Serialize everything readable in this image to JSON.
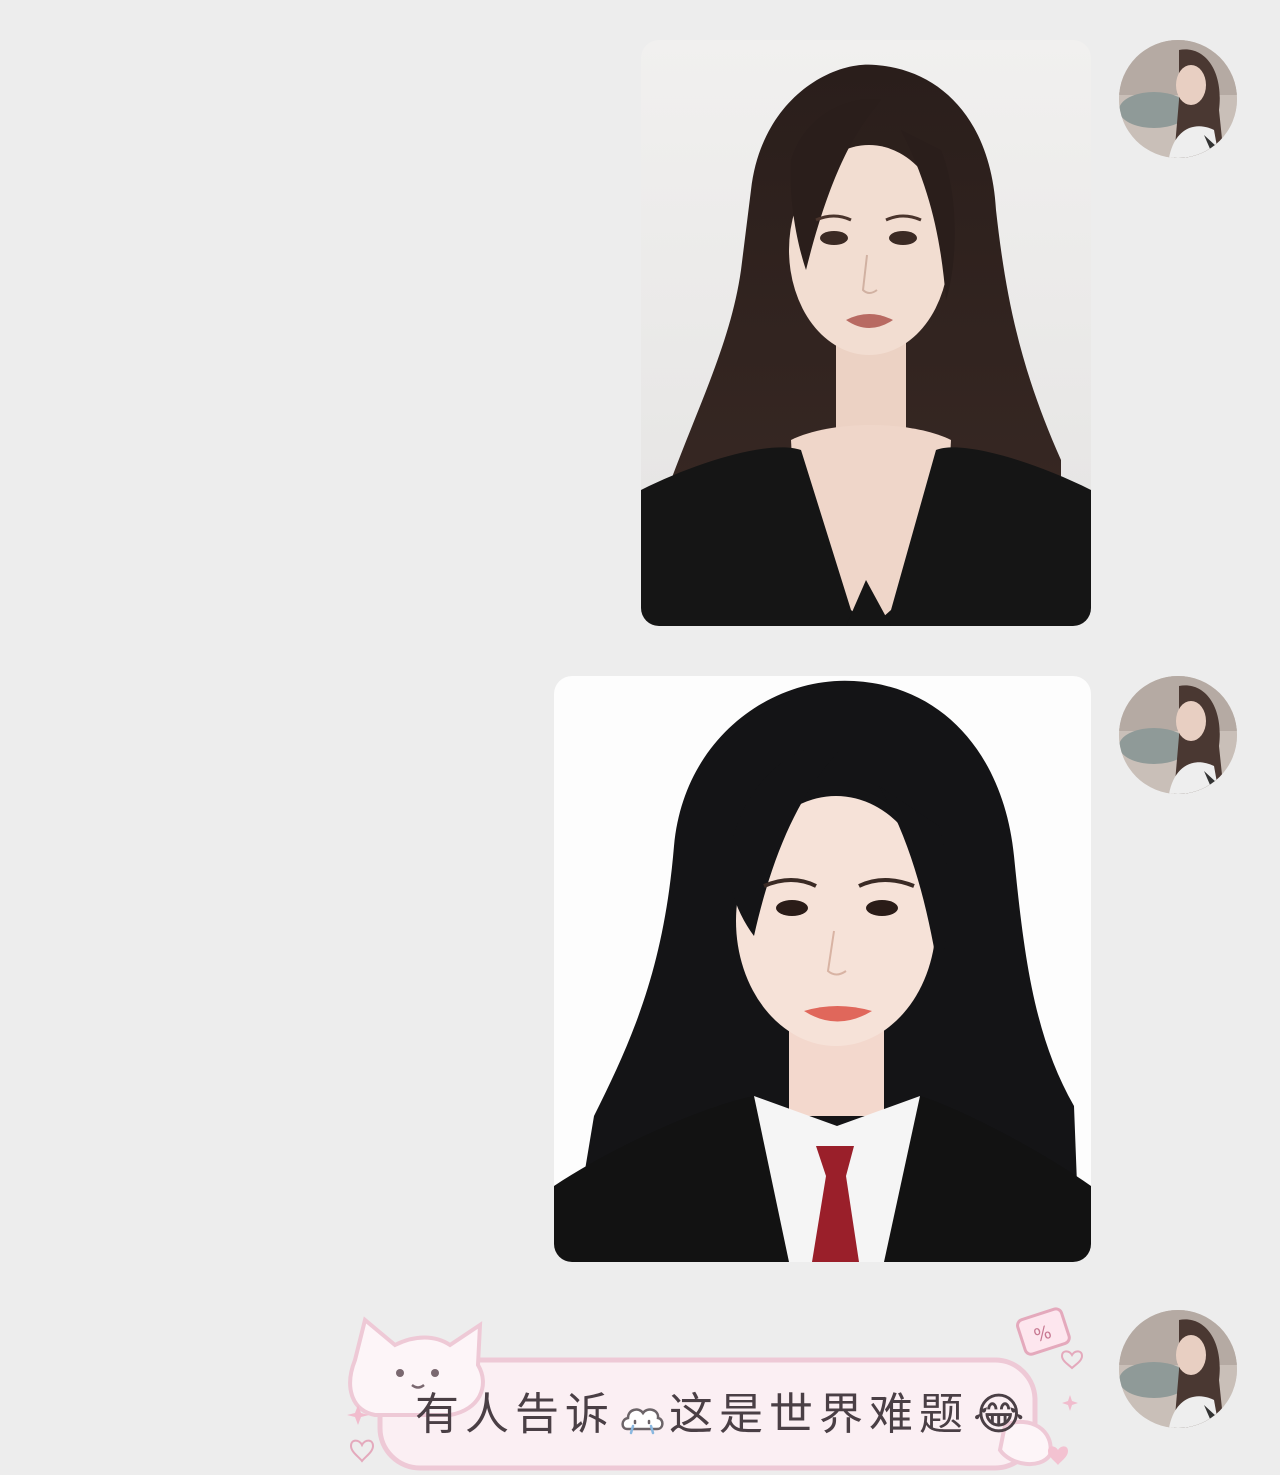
{
  "chat": {
    "messages": [
      {
        "type": "image",
        "sender": "self",
        "description_icon": "portrait-photo"
      },
      {
        "type": "image",
        "sender": "self",
        "description_icon": "portrait-photo"
      },
      {
        "type": "sticker-text",
        "sender": "self",
        "text_before": "有人告诉",
        "text_after": "这是世界难题",
        "inline_icon": "crying-cloud-icon",
        "trailing_emoji": "😂"
      }
    ]
  },
  "colors": {
    "background": "#ededed",
    "sticker_fill": "#fbeff3",
    "sticker_border": "#eec9d6",
    "text": "#4a3f45"
  }
}
